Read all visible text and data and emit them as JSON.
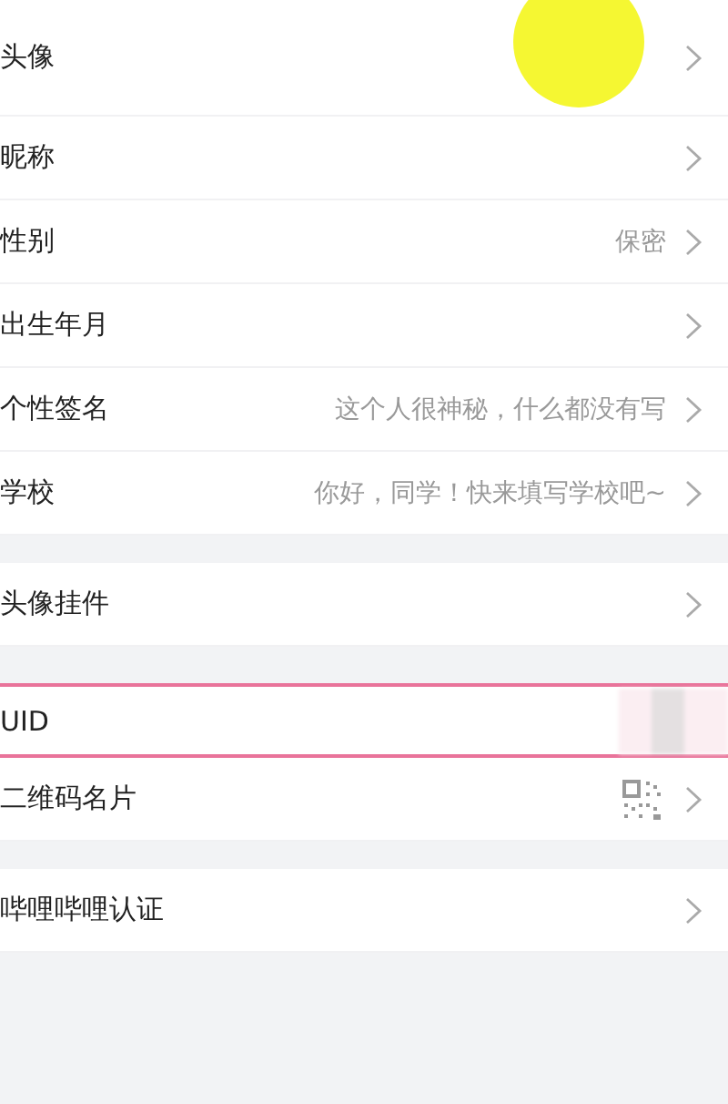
{
  "groups": [
    {
      "rows": [
        {
          "kind": "avatar",
          "label": "头像",
          "chevron": true
        },
        {
          "kind": "plain",
          "label": "昵称",
          "chevron": true
        },
        {
          "kind": "value",
          "label": "性别",
          "value": "保密",
          "chevron": true
        },
        {
          "kind": "plain",
          "label": "出生年月",
          "chevron": true
        },
        {
          "kind": "value",
          "label": "个性签名",
          "value": "这个人很神秘，什么都没有写",
          "chevron": true
        },
        {
          "kind": "value",
          "label": "学校",
          "value": "你好，同学！快来填写学校吧~",
          "chevron": true
        }
      ]
    },
    {
      "rows": [
        {
          "kind": "plain",
          "label": "头像挂件",
          "chevron": true
        }
      ]
    },
    {
      "rows": [
        {
          "kind": "hidden",
          "label": "UID",
          "chevron": false,
          "highlighted": true
        },
        {
          "kind": "qr",
          "label": "二维码名片",
          "chevron": true
        }
      ]
    },
    {
      "rows": [
        {
          "kind": "plain",
          "label": "哔哩哔哩认证",
          "chevron": true
        }
      ]
    }
  ]
}
